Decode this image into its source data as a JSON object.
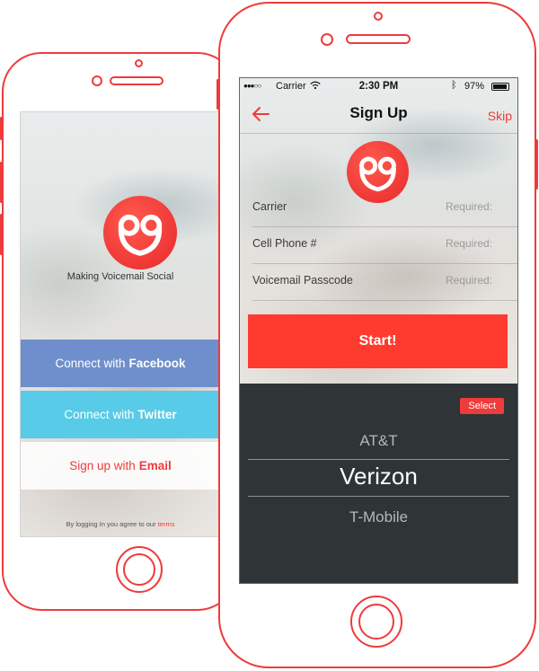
{
  "colors": {
    "accent": "#ef3b3b",
    "facebook": "#6f8fcc",
    "twitter": "#57cbe8",
    "start_button": "#ff3b30",
    "picker_bg": "#2f3436"
  },
  "left_phone": {
    "tagline": "Making Voicemail Social",
    "buttons": {
      "facebook": {
        "prefix": "Connect with",
        "bold": "Facebook"
      },
      "twitter": {
        "prefix": "Connect with",
        "bold": "Twitter"
      },
      "email": {
        "prefix": "Sign up with",
        "bold": "Email"
      }
    },
    "legal": {
      "text": "By logging In you agree to our",
      "link": "terms"
    }
  },
  "right_phone": {
    "status": {
      "carrier": "Carrier",
      "time": "2:30 PM",
      "battery": "97%"
    },
    "nav": {
      "back_icon": "back-arrow-icon",
      "title": "Sign Up",
      "skip": "Skip"
    },
    "form": [
      {
        "label": "Carrier",
        "placeholder": "Required:"
      },
      {
        "label": "Cell Phone #",
        "placeholder": "Required:"
      },
      {
        "label": "Voicemail Passcode",
        "placeholder": "Required:"
      }
    ],
    "start_label": "Start!",
    "picker": {
      "select_label": "Select",
      "options": [
        "AT&T",
        "Verizon",
        "T-Mobile"
      ],
      "selected": "Verizon"
    }
  }
}
